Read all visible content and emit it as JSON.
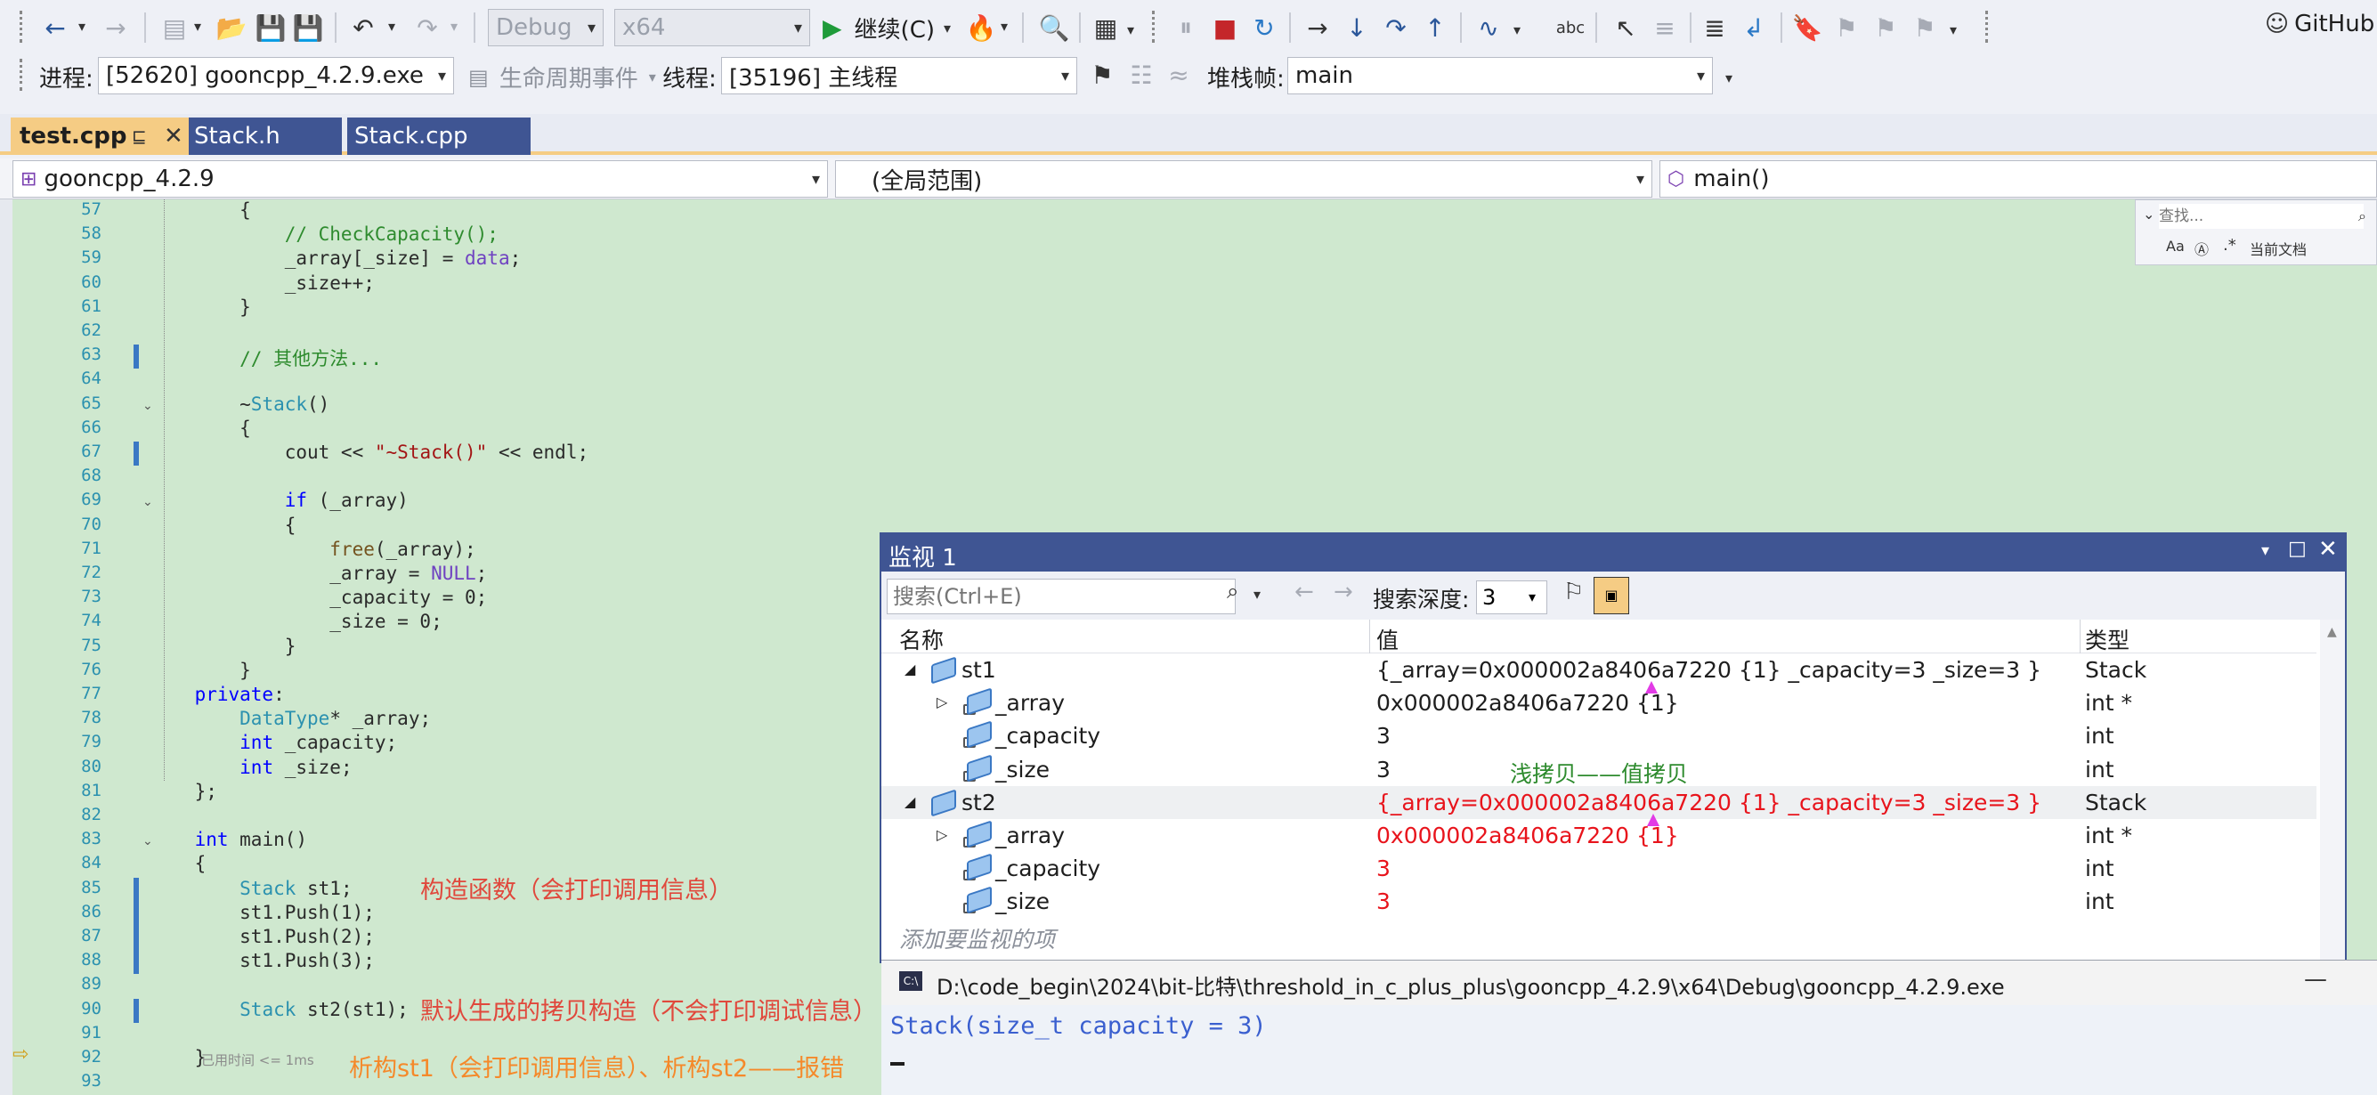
{
  "toolbar": {
    "config": "Debug",
    "platform": "x64",
    "continue_label": "继续(C)",
    "github_label": "GitHub"
  },
  "debug_bar": {
    "process_label": "进程:",
    "process_value": "[52620] gooncpp_4.2.9.exe",
    "lifecycle_label": "生命周期事件",
    "thread_label": "线程:",
    "thread_value": "[35196] 主线程",
    "stackframe_label": "堆栈帧:",
    "stackframe_value": "main"
  },
  "tabs": [
    {
      "label": "test.cpp",
      "active": true
    },
    {
      "label": "Stack.h",
      "active": false
    },
    {
      "label": "Stack.cpp",
      "active": false
    }
  ],
  "nav": {
    "project": "gooncpp_4.2.9",
    "scope": "(全局范围)",
    "member": "main()"
  },
  "find": {
    "placeholder": "查找...",
    "opt_case": "Aa",
    "opt_scope": "当前文档"
  },
  "code": {
    "line_numbers": [
      "57",
      "58",
      "59",
      "60",
      "61",
      "62",
      "63",
      "64",
      "65",
      "66",
      "67",
      "68",
      "69",
      "70",
      "71",
      "72",
      "73",
      "74",
      "75",
      "76",
      "77",
      "78",
      "79",
      "80",
      "81",
      "82",
      "83",
      "84",
      "85",
      "86",
      "87",
      "88",
      "89",
      "90",
      "91",
      "92",
      "93"
    ],
    "elapsed_hint": "已用时间 <= 1ms"
  },
  "annotations": {
    "ctor": "构造函数（会打印调用信息）",
    "copy": "默认生成的拷贝构造（不会打印调试信息）",
    "dtor": "析构st1（会打印调用信息）、析构st2——报错",
    "shallow": "浅拷贝——值拷贝"
  },
  "watch": {
    "title": "监视 1",
    "search_placeholder": "搜索(Ctrl+E)",
    "depth_label": "搜索深度:",
    "depth_value": "3",
    "col_name": "名称",
    "col_value": "值",
    "col_type": "类型",
    "rows": [
      {
        "name": "st1",
        "value": "{_array=0x000002a8406a7220 {1} _capacity=3 _size=3 }",
        "type": "Stack"
      },
      {
        "name": "_array",
        "value": "0x000002a8406a7220 {1}",
        "type": "int *"
      },
      {
        "name": "_capacity",
        "value": "3",
        "type": "int"
      },
      {
        "name": "_size",
        "value": "3",
        "type": "int"
      },
      {
        "name": "st2",
        "value": "{_array=0x000002a8406a7220 {1} _capacity=3 _size=3 }",
        "type": "Stack"
      },
      {
        "name": "_array",
        "value": "0x000002a8406a7220 {1}",
        "type": "int *"
      },
      {
        "name": "_capacity",
        "value": "3",
        "type": "int"
      },
      {
        "name": "_size",
        "value": "3",
        "type": "int"
      }
    ],
    "add_item": "添加要监视的项"
  },
  "console": {
    "path": "D:\\code_begin\\2024\\bit-比特\\threshold_in_c_plus_plus\\gooncpp_4.2.9\\x64\\Debug\\gooncpp_4.2.9.exe",
    "output": "Stack(size_t capacity = 3)"
  }
}
